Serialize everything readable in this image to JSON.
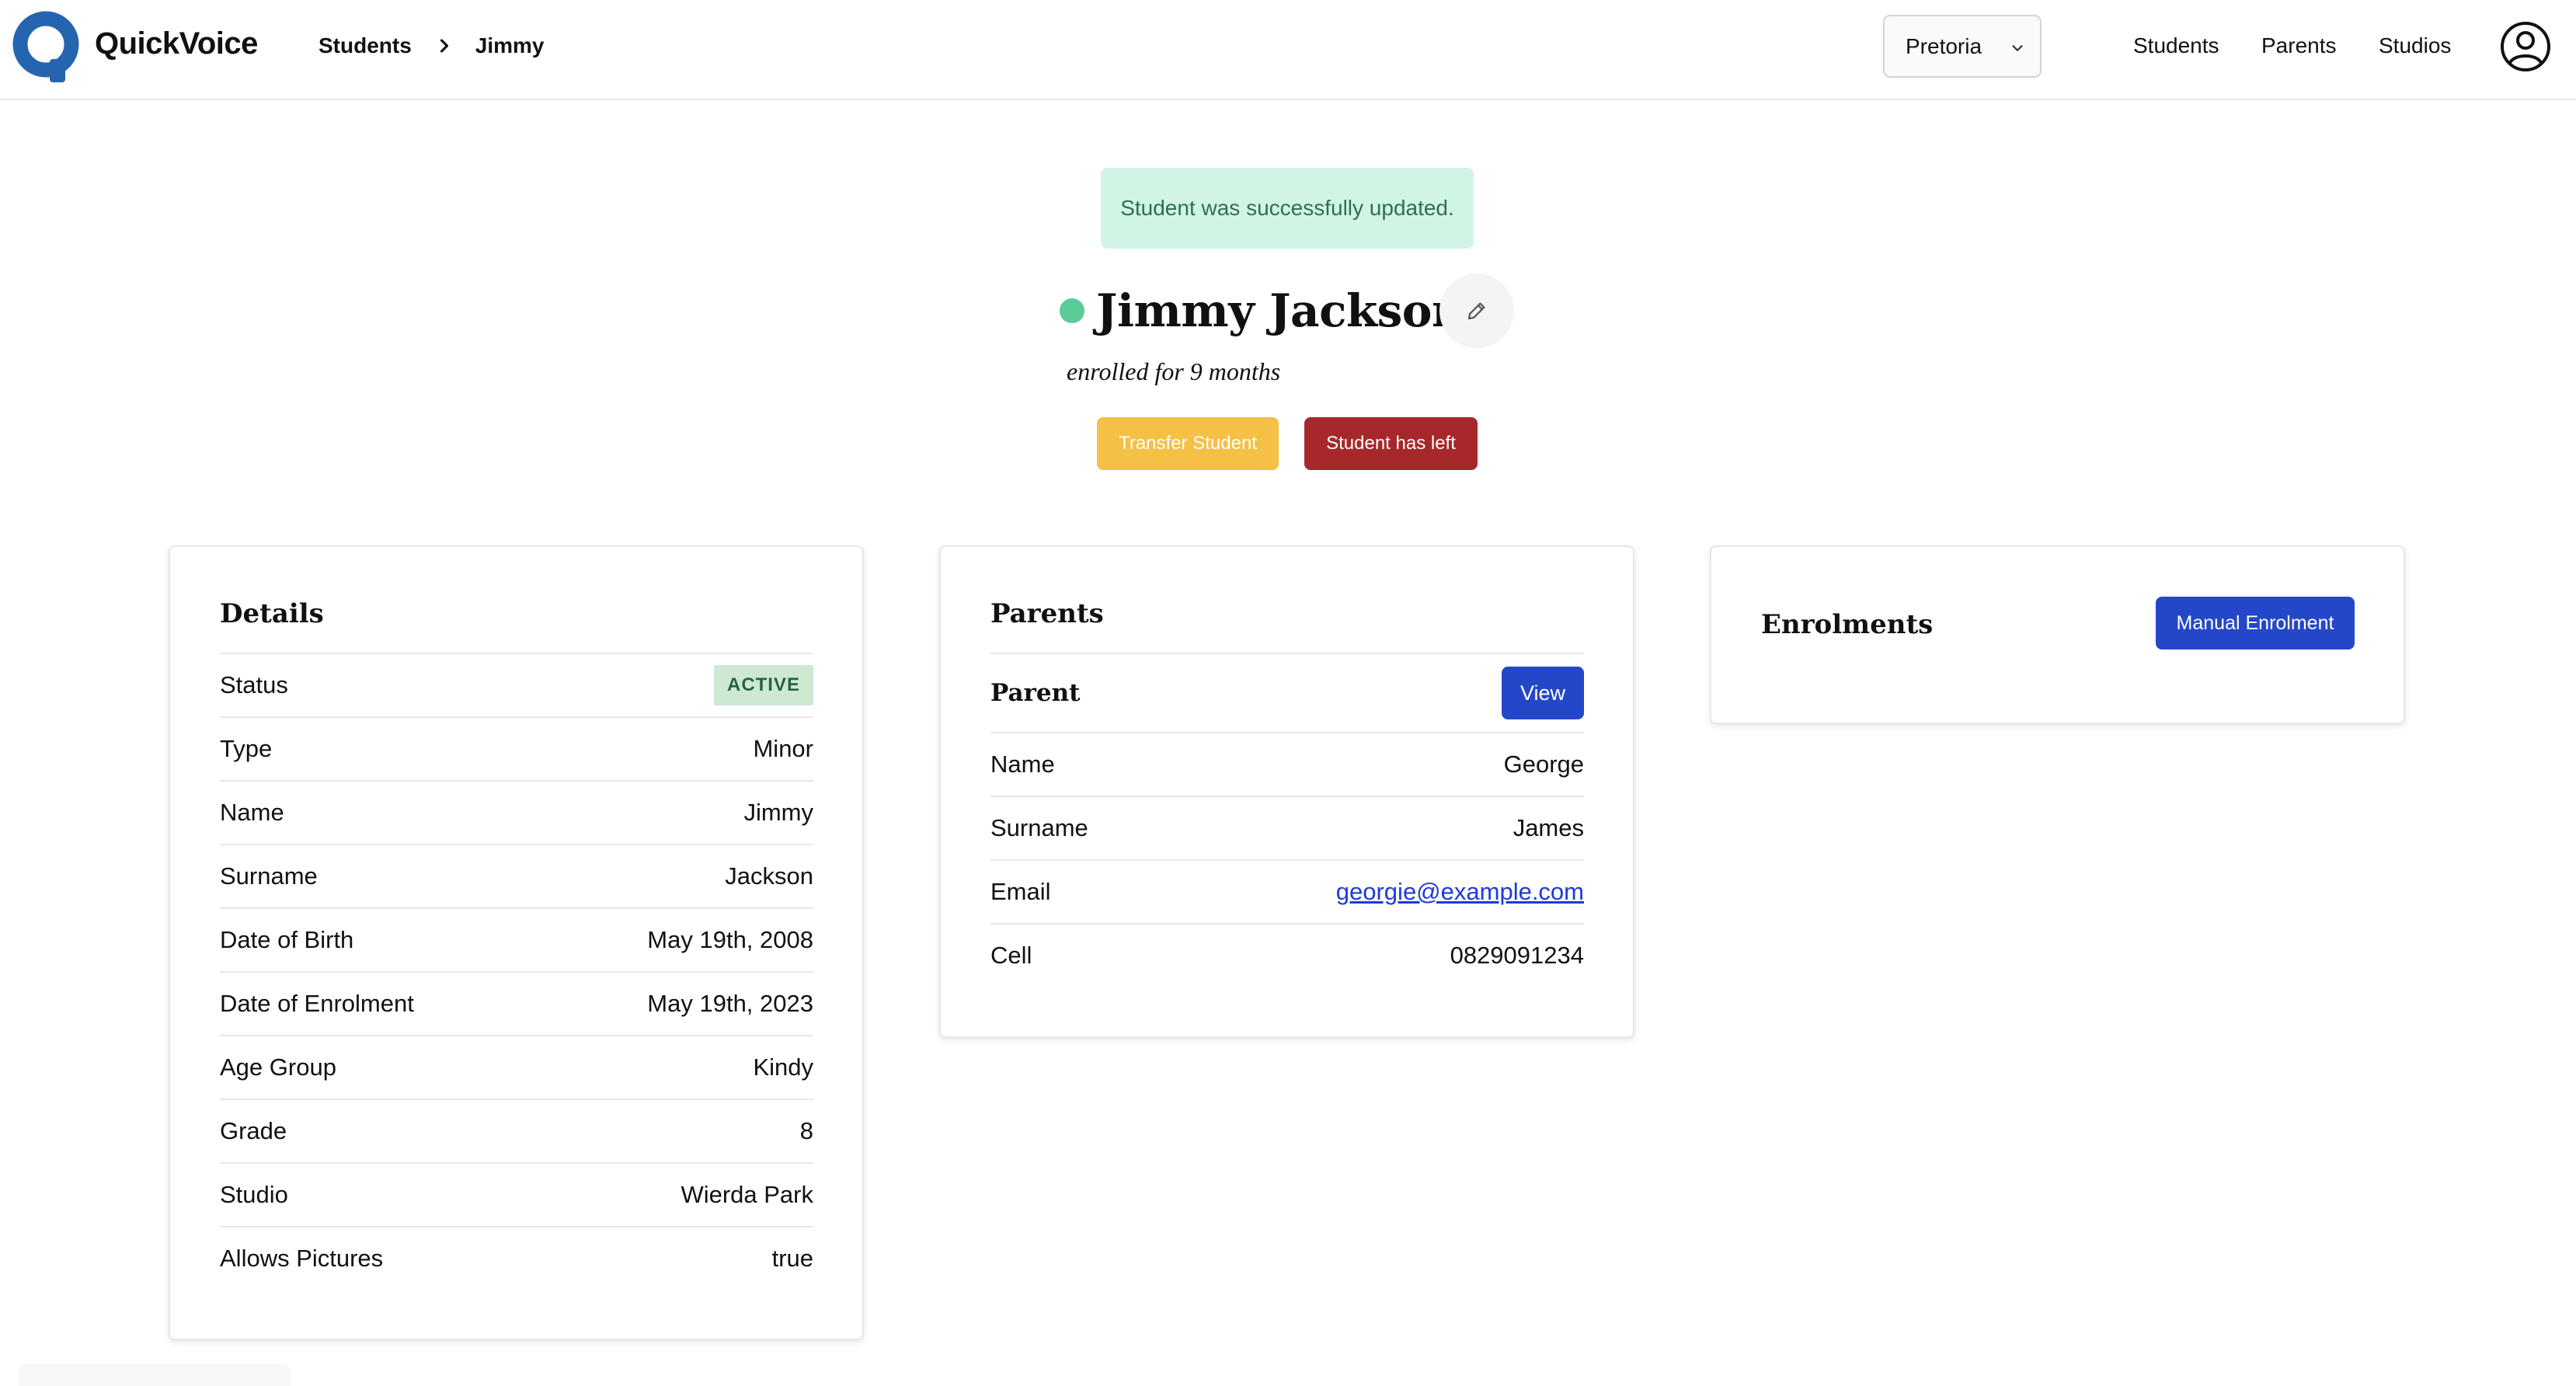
{
  "app": {
    "name": "QuickVoice"
  },
  "breadcrumb": {
    "items": [
      "Students",
      "Jimmy"
    ]
  },
  "location_select": {
    "value": "Pretoria"
  },
  "nav": {
    "students": "Students",
    "parents": "Parents",
    "studios": "Studios"
  },
  "icons": {
    "logo": "quickvoice-logo-icon",
    "separator": "chevron-right-icon",
    "select": "chevron-down-icon",
    "account": "user-circle-icon",
    "edit": "pencil-icon",
    "status": "status-dot-icon"
  },
  "alert": {
    "message": "Student was successfully updated."
  },
  "student": {
    "name": "Jimmy Jackson",
    "subtitle": "enrolled for 9 months",
    "status_color": "#5bcb95"
  },
  "actions": {
    "transfer": "Transfer Student",
    "left": "Student has left"
  },
  "details": {
    "title": "Details",
    "status": {
      "label": "Status",
      "value": "ACTIVE"
    },
    "rows": [
      {
        "label": "Type",
        "value": "Minor"
      },
      {
        "label": "Name",
        "value": "Jimmy"
      },
      {
        "label": "Surname",
        "value": "Jackson"
      },
      {
        "label": "Date of Birth",
        "value": "May 19th, 2008"
      },
      {
        "label": "Date of Enrolment",
        "value": "May 19th, 2023"
      },
      {
        "label": "Age Group",
        "value": "Kindy"
      },
      {
        "label": "Grade",
        "value": "8"
      },
      {
        "label": "Studio",
        "value": "Wierda Park"
      },
      {
        "label": "Allows Pictures",
        "value": "true"
      }
    ]
  },
  "parents": {
    "title": "Parents",
    "parent_heading": "Parent",
    "view_label": "View",
    "rows": [
      {
        "label": "Name",
        "value": "George"
      },
      {
        "label": "Surname",
        "value": "James"
      },
      {
        "label": "Email",
        "value": "georgie@example.com"
      },
      {
        "label": "Cell",
        "value": "0829091234"
      }
    ]
  },
  "enrolments": {
    "title": "Enrolments",
    "manual_label": "Manual Enrolment"
  },
  "colors": {
    "primary": "#2447c9",
    "warning": "#f4c045",
    "danger": "#a6282b",
    "success_bg": "#d1f5e4",
    "success_text": "#2f6e55",
    "logo": "#2565b0"
  }
}
